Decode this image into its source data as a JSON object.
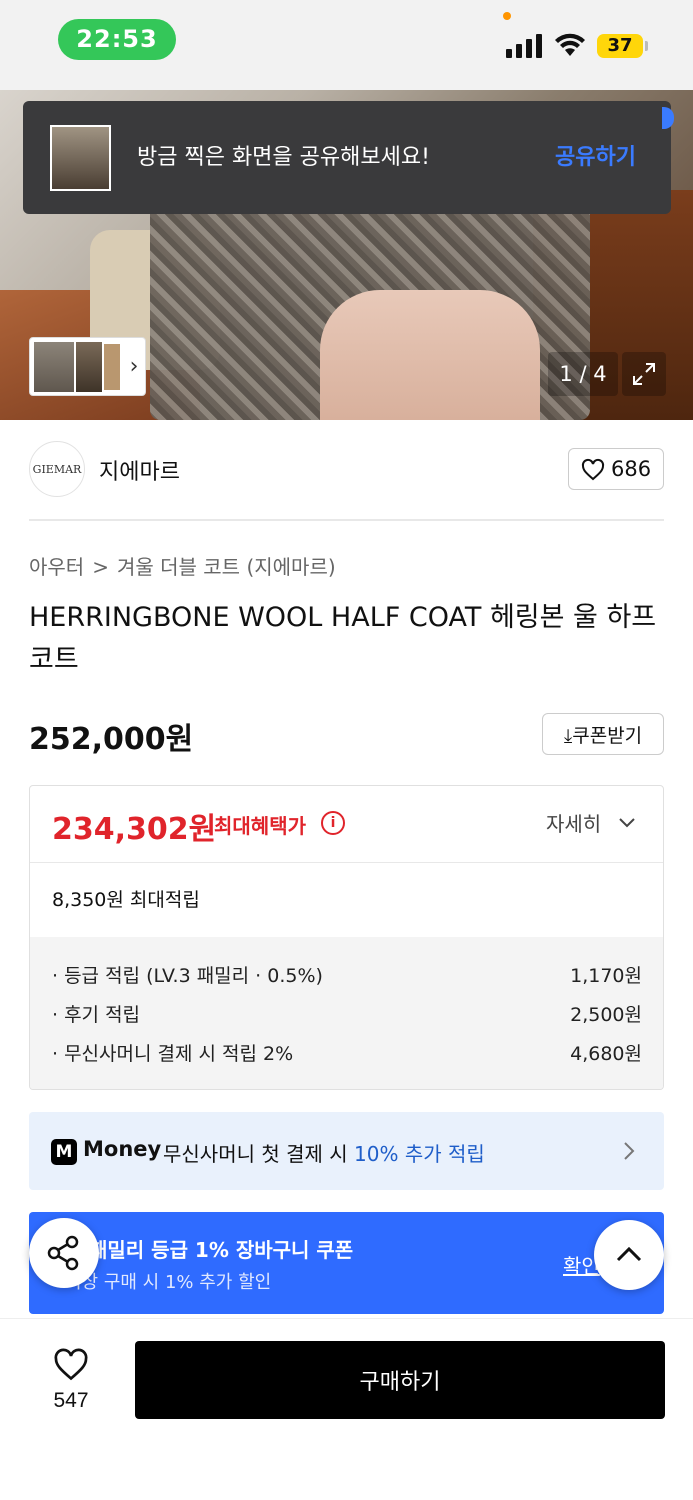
{
  "status_bar": {
    "time": "22:53",
    "battery": "37"
  },
  "share_toast": {
    "message": "방금 찍은 화면을 공유해보세요!",
    "action": "공유하기"
  },
  "gallery": {
    "page_indicator": "1 / 4"
  },
  "brand": {
    "logo_text": "GIEMAR",
    "name": "지에마르",
    "likes": "686"
  },
  "product": {
    "breadcrumb": [
      "아우터",
      "겨울 더블 코트 (지에마르)"
    ],
    "title": "HERRINGBONE WOOL HALF COAT 헤링본 울 하프코트",
    "price": "252,000원",
    "coupon_button": "쿠폰받기"
  },
  "benefits": {
    "best_price": "234,302원",
    "best_price_label": "최대혜택가",
    "detail_toggle": "자세히",
    "max_points": "8,350원 최대적립",
    "rows": [
      {
        "label": "· 등급 적립 (LV.3 패밀리 · 0.5%)",
        "value": "1,170원"
      },
      {
        "label": "· 후기 적립",
        "value": "2,500원"
      },
      {
        "label": "· 무신사머니 결제 시 적립 2%",
        "value": "4,680원"
      }
    ]
  },
  "money_banner": {
    "logo": "M",
    "brand": "Money",
    "text": "무신사머니 첫 결제 시 ",
    "highlight": "10% 추가 적립"
  },
  "family_banner": {
    "title": "패밀리 등급 1% 장바구니 쿠폰",
    "subtitle": "이상 구매 시 1% 추가 할인",
    "confirm": "확인"
  },
  "bottom_bar": {
    "likes": "547",
    "buy_label": "구매하기"
  },
  "colors": {
    "accent_red": "#e0242b",
    "accent_blue": "#2f6bff",
    "link_blue": "#3a7bff",
    "money_blue": "#1f5ec9"
  }
}
